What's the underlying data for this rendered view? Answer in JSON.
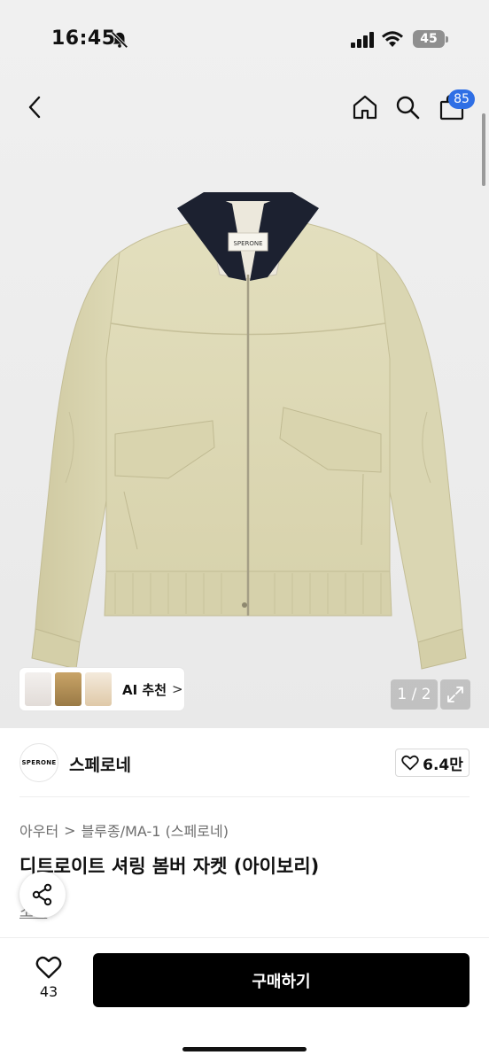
{
  "status_bar": {
    "time": "16:45",
    "battery": "45"
  },
  "header": {
    "cart_count": "85"
  },
  "gallery": {
    "jacket_label": "SPERONE",
    "ai_recommend_label": "AI 추천",
    "ai_chevron": ">",
    "pager": "1 / 2"
  },
  "brand": {
    "logo_text": "SPERONE",
    "name": "스페로네",
    "likes": "6.4만"
  },
  "product": {
    "breadcrumb": [
      "아우터",
      "블루종/MA-1 (스페로네)"
    ],
    "breadcrumb_sep": ">",
    "title": "디트로이트 셔링 봄버 자켓 (아이보리)",
    "review_link": "소개"
  },
  "bottom_bar": {
    "like_count": "43",
    "buy_label": "구매하기"
  },
  "colors": {
    "accent_badge": "#2f6fe5",
    "buy_button": "#000000",
    "jacket_body": "#dfdcb8",
    "collar": "#1c2130"
  }
}
